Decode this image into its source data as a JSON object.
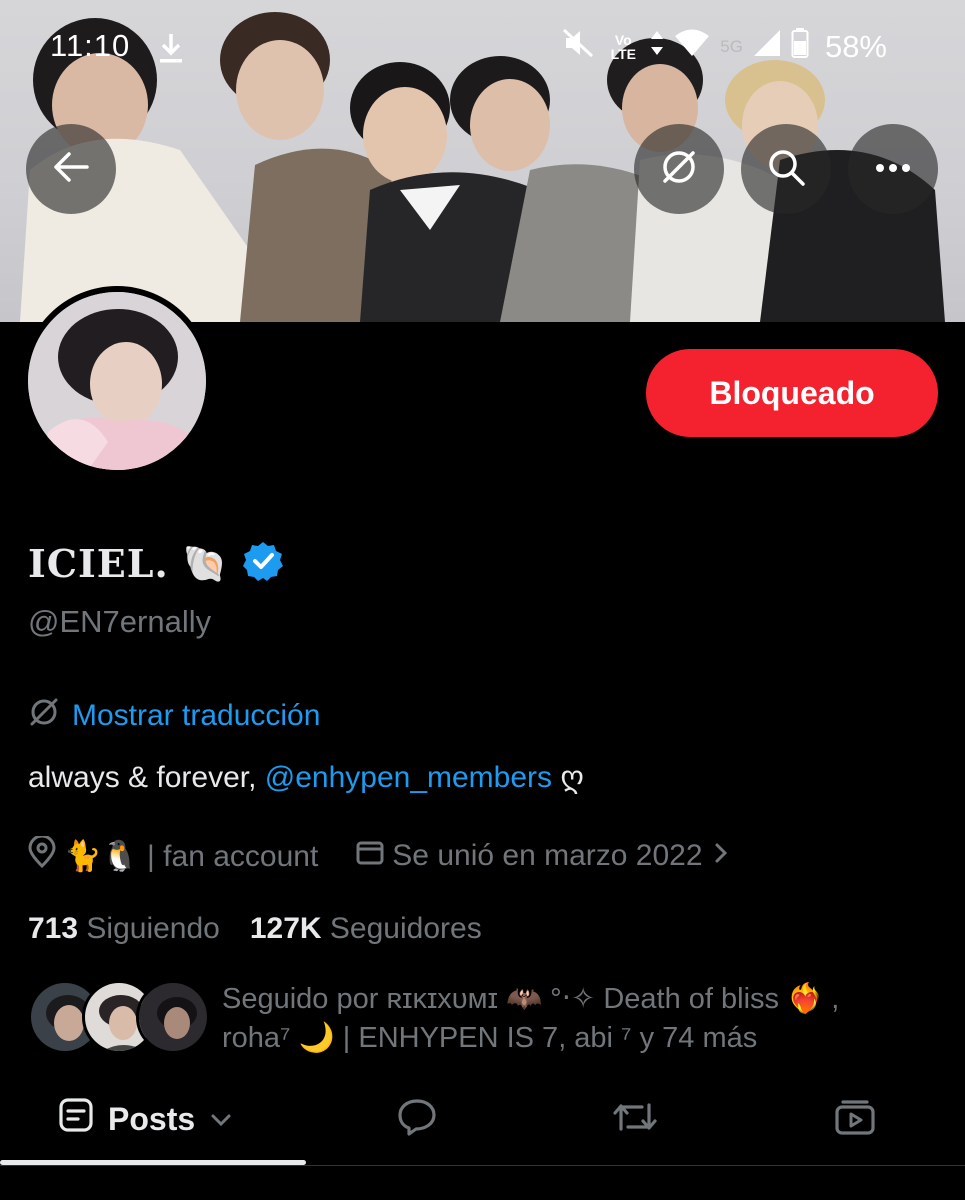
{
  "status_bar": {
    "time": "11:10",
    "network_label": "Vo LTE",
    "network_type": "5G",
    "battery": "58%",
    "icons": [
      "download-icon",
      "mute-icon",
      "wifi-icon",
      "signal-icon",
      "battery-icon"
    ]
  },
  "header": {
    "back_icon": "back-arrow-icon",
    "translate_icon": "translate-off-icon",
    "search_icon": "search-icon",
    "more_icon": "more-icon"
  },
  "profile": {
    "display_name": "ICIEL.",
    "name_emoji": "🐚",
    "verified": true,
    "handle": "@EN7ernally",
    "block_button": "Bloqueado",
    "translate_link": "Mostrar traducción",
    "bio_prefix": "always & forever, ",
    "bio_mention": "@enhypen_members",
    "bio_suffix": " ღ",
    "location": "🐈🐧 | fan account",
    "joined": "Se unió en marzo 2022",
    "following_count": "713",
    "following_label": "Siguiendo",
    "followers_count": "127K",
    "followers_label": "Seguidores",
    "followed_by_line1": "Seguido por ʀɪᴋɪxᴜᴍɪ 🦇 °‧✧ Death of bliss ❤️‍🔥 ,",
    "followed_by_line2": "roha⁷ 🌙 | ENHYPEN IS 7, abi ⁷ y 74 más"
  },
  "tabs": {
    "posts_label": "Posts"
  },
  "colors": {
    "accent_blue": "#1d9bf0",
    "block_red": "#f4212e",
    "muted_text": "#71767b",
    "primary_text": "#e7e9ea"
  }
}
